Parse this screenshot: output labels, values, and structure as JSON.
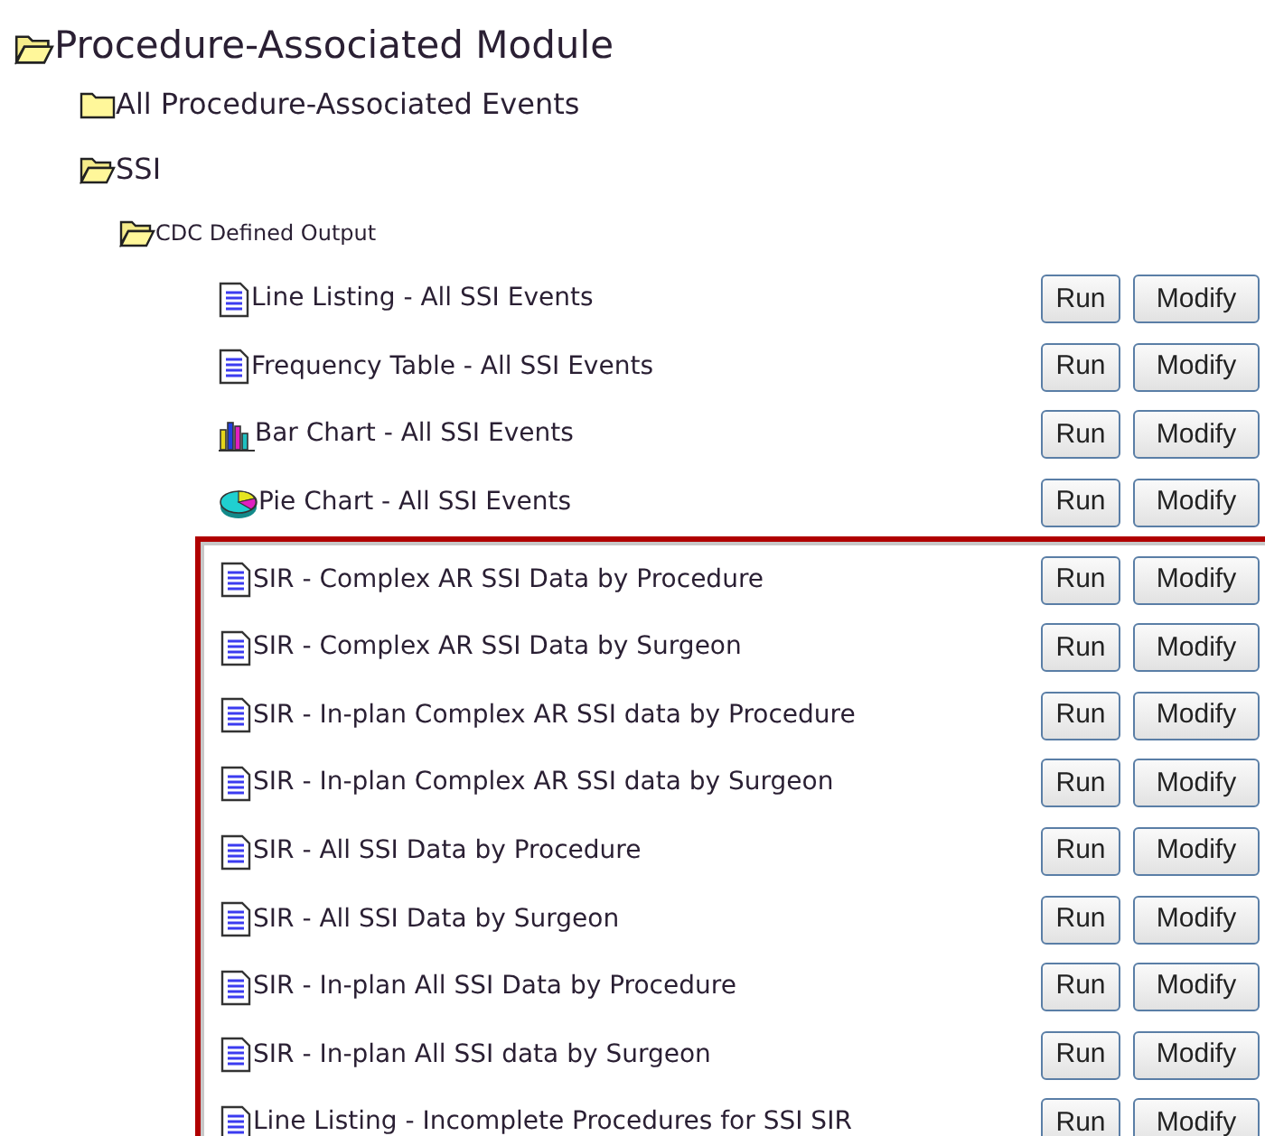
{
  "module": {
    "title": "Procedure-Associated Module",
    "folders": [
      {
        "title": "All Procedure-Associated Events",
        "open": false
      },
      {
        "title": "SSI",
        "open": true,
        "children": [
          {
            "title": "CDC Defined Output",
            "open": true
          }
        ]
      }
    ]
  },
  "outputs": [
    {
      "kind": "report",
      "title": "Line Listing - All SSI Events",
      "buttons": [
        "Run",
        "Modify"
      ]
    },
    {
      "kind": "report",
      "title": "Frequency Table - All SSI Events",
      "buttons": [
        "Run",
        "Modify"
      ]
    },
    {
      "kind": "bar",
      "title": "Bar Chart - All SSI Events",
      "buttons": [
        "Run",
        "Modify"
      ]
    },
    {
      "kind": "pie",
      "title": "Pie Chart - All SSI Events",
      "buttons": [
        "Run",
        "Modify"
      ]
    }
  ],
  "highlighted_outputs": [
    {
      "kind": "report",
      "title": "SIR - Complex AR SSI Data by Procedure",
      "buttons": [
        "Run",
        "Modify"
      ]
    },
    {
      "kind": "report",
      "title": "SIR - Complex AR SSI Data by Surgeon",
      "buttons": [
        "Run",
        "Modify"
      ]
    },
    {
      "kind": "report",
      "title": "SIR - In-plan Complex AR SSI data by Procedure",
      "buttons": [
        "Run",
        "Modify"
      ]
    },
    {
      "kind": "report",
      "title": "SIR - In-plan Complex AR SSI data by Surgeon",
      "buttons": [
        "Run",
        "Modify"
      ]
    },
    {
      "kind": "report",
      "title": "SIR - All SSI Data by Procedure",
      "buttons": [
        "Run",
        "Modify"
      ]
    },
    {
      "kind": "report",
      "title": "SIR - All SSI Data by Surgeon",
      "buttons": [
        "Run",
        "Modify"
      ]
    },
    {
      "kind": "report",
      "title": "SIR - In-plan All SSI Data by Procedure",
      "buttons": [
        "Run",
        "Modify"
      ]
    },
    {
      "kind": "report",
      "title": "SIR - In-plan All SSI data by Surgeon",
      "buttons": [
        "Run",
        "Modify"
      ]
    },
    {
      "kind": "report",
      "title": "Line Listing - Incomplete Procedures for SSI SIR",
      "buttons": [
        "Run",
        "Modify"
      ]
    }
  ]
}
